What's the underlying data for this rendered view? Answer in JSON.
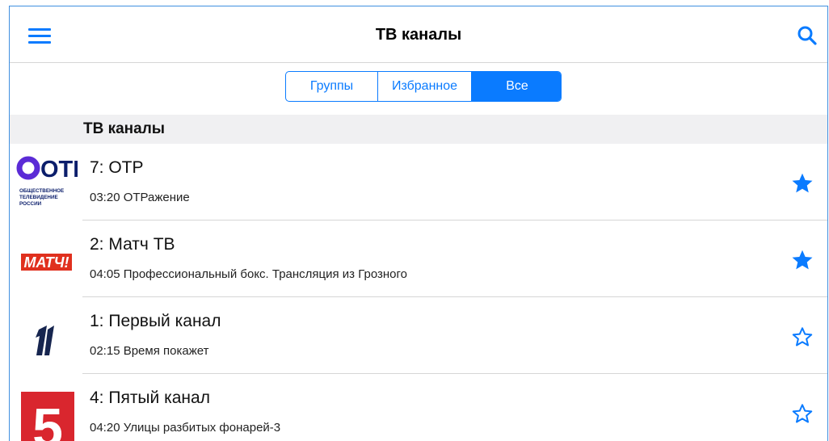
{
  "navbar": {
    "title": "ТВ каналы",
    "menu_icon": "hamburger-menu-icon",
    "search_icon": "search-icon"
  },
  "segments": [
    {
      "label": "Группы",
      "active": false
    },
    {
      "label": "Избранное",
      "active": false
    },
    {
      "label": "Все",
      "active": true
    }
  ],
  "section": {
    "header": "ТВ каналы"
  },
  "channels": [
    {
      "name": "7: ОТР",
      "program": "03:20 ОТРажение",
      "favorite": true,
      "logo": "otr-logo",
      "logo_text": [
        "ОТР",
        "ОБЩЕСТВЕННОЕ",
        "ТЕЛЕВИДЕНИЕ",
        "РОССИИ"
      ]
    },
    {
      "name": "2: Матч ТВ",
      "program": "04:05 Профессиональный бокс. Трансляция из Грозного",
      "favorite": true,
      "logo": "match-tv-logo",
      "logo_text": [
        "МАТЧ!"
      ]
    },
    {
      "name": "1: Первый канал",
      "program": "02:15 Время покажет",
      "favorite": false,
      "logo": "channel-one-logo",
      "logo_text": []
    },
    {
      "name": "4: Пятый канал",
      "program": "04:20 Улицы разбитых фонарей-3",
      "favorite": false,
      "logo": "channel-five-logo",
      "logo_text": [
        "5"
      ]
    }
  ],
  "colors": {
    "accent": "#0a7bff",
    "otr_ring": "#5b2bd6",
    "match_red": "#e0301e",
    "five_red": "#d9262e",
    "separator": "#d6d6d6",
    "section_bg": "#f0f0f2"
  }
}
